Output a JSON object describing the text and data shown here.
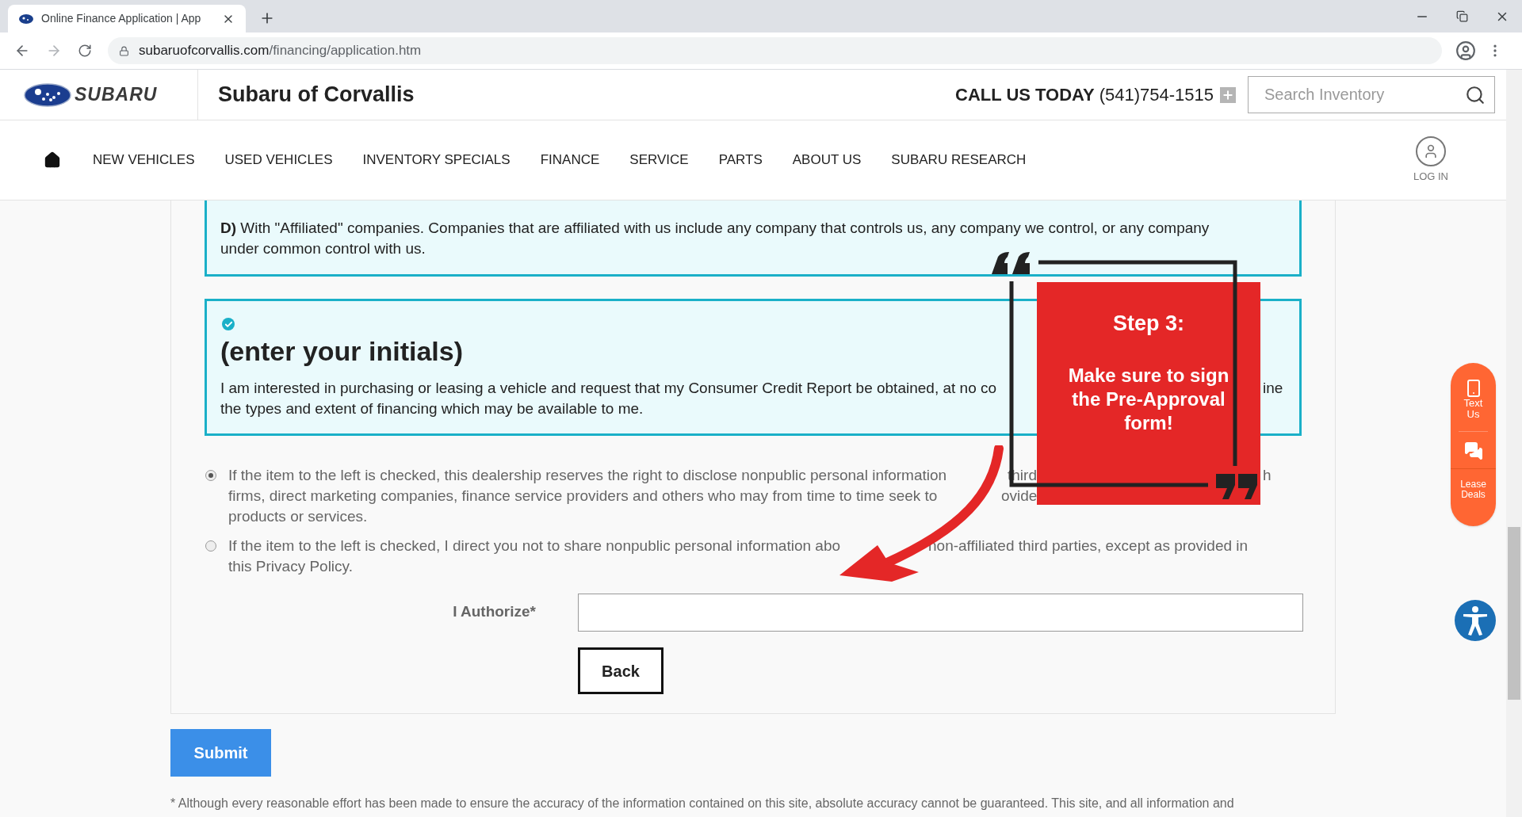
{
  "browser": {
    "tab_title": "Online Finance Application | App",
    "url_domain": "subaruofcorvallis.com",
    "url_path": "/financing/application.htm"
  },
  "header": {
    "brand": "SUBARU",
    "dealer_name": "Subaru of Corvallis",
    "call_label": "CALL US TODAY",
    "phone": "(541)754-1515",
    "search": {
      "placeholder": "Search Inventory"
    }
  },
  "nav": {
    "items": [
      "NEW VEHICLES",
      "USED VEHICLES",
      "INVENTORY SPECIALS",
      "FINANCE",
      "SERVICE",
      "PARTS",
      "ABOUT US",
      "SUBARU RESEARCH"
    ],
    "login": "LOG IN"
  },
  "notice": {
    "text": "**D)** With \"Affiliated\" companies. Companies that are affiliated with us include any company that controls us, any company we control, or any company under common control with us."
  },
  "consent": {
    "heading": "(enter your initials)",
    "lines": [
      [
        "I am interested in purchasing or leasing a vehicle and request that my Consumer Credit Report be obtained, at no co",
        "ine"
      ],
      [
        "the types and extent of financing which may be available to me."
      ]
    ]
  },
  "options": [
    {
      "selected": true,
      "lines": [
        [
          "If the item to the left is checked, this dealership reserves the right to disclose nonpublic personal information",
          "third",
          "h"
        ],
        [
          "firms, direct marketing companies, finance service providers and others who may from time to time seek to",
          "ovide"
        ],
        [
          "products or services."
        ]
      ]
    },
    {
      "selected": false,
      "lines": [
        [
          "If the item to the left is checked, I direct you not to share nonpublic personal information abo",
          "non-affiliated third parties, except as provided in"
        ],
        [
          "this Privacy Policy."
        ]
      ]
    }
  ],
  "authorize": {
    "label": "I Authorize*"
  },
  "buttons": {
    "back": "Back",
    "submit": "Submit"
  },
  "footnote": "* Although every reasonable effort has been made to ensure the accuracy of the information contained on this site, absolute accuracy cannot be guaranteed. This site, and all information and",
  "side_widget": {
    "text_us": "Text Us",
    "lease_deals": "Lease Deals"
  },
  "callout": {
    "title": "Step 3:",
    "message": "Make sure to sign the Pre-Approval form!"
  }
}
